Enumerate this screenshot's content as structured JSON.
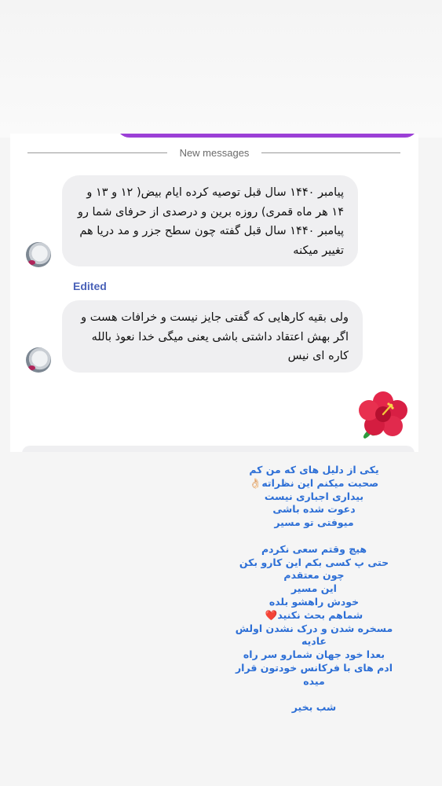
{
  "chat": {
    "divider_text": "New messages",
    "message1": "پیامبر ۱۴۴۰ سال قبل توصیه کرده ایام بیض( ۱۲ و ۱۳ و ۱۴ هر ماه قمری)  روزه برین و درصدی از حرفای شما رو پیامبر ۱۴۴۰ سال قبل گفته چون سطح جزر و مد دریا هم تغییر میکنه",
    "edited_label": "Edited",
    "message2": "ولی بقیه کارهایی که گفتی جایز نیست و خرافات هست و اگر بهش اعتقاد داشتی باشی یعنی میگی خدا نعوذ بالله کاره ای نیس",
    "reaction_icon": "hibiscus-flower-icon"
  },
  "caption": {
    "lines": [
      "یکی از دلیل های که من کم",
      "صحبت میکنم این نظراته👌🏻",
      "بیداری اجباری نیست",
      "دعوت شده باشی",
      "میوفتی تو مسیر",
      "",
      "هیچ وقتم سعی نکردم",
      "حتی پ کسی بکم این کارو بکن",
      "چون معتقدم",
      "این مسیر",
      "خودش راهشو بلده",
      "شماهم بحث نکنید❤️",
      "مسخره شدن و درک نشدن اولش",
      "عادیه",
      "بعدا خود جهان شمارو سر راه",
      "ادم های با فرکانس خودتون قرار",
      "میده",
      "",
      "شب بخیر"
    ]
  },
  "colors": {
    "caption_text": "#2d6fd6",
    "bubble_bg": "#efeff1",
    "edited_label": "#4a62b8",
    "accent_bar": "#9b3fd6"
  }
}
